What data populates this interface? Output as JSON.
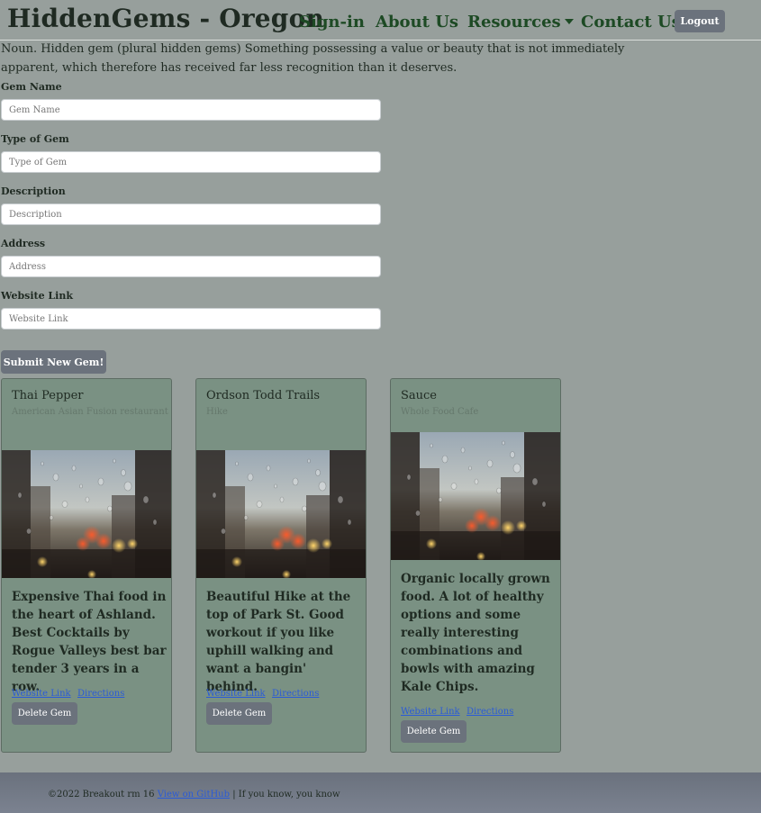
{
  "navbar": {
    "brand": "HiddenGems - Oregon",
    "links": [
      "Sign-in",
      "About Us",
      "Resources",
      "Contact Us"
    ],
    "logout_label": "Logout"
  },
  "intro": "Noun. Hidden gem (plural hidden gems) Something possessing a value or beauty that is not immediately apparent, which therefore has received far less recognition than it deserves.",
  "form": {
    "fields": [
      {
        "label": "Gem Name",
        "placeholder": "Gem Name",
        "value": ""
      },
      {
        "label": "Type of Gem",
        "placeholder": "Type of Gem",
        "value": ""
      },
      {
        "label": "Description",
        "placeholder": "Description",
        "value": ""
      },
      {
        "label": "Address",
        "placeholder": "Address",
        "value": ""
      },
      {
        "label": "Website Link",
        "placeholder": "Website Link",
        "value": ""
      }
    ],
    "submit_label": "Submit New Gem!"
  },
  "cards": [
    {
      "title": "Thai Pepper",
      "subtitle": "American Asian Fusion restaurant",
      "text": "Expensive Thai food in the heart of Ashland. Best Cocktails by Rogue Valleys best bar tender 3 years in a row.",
      "website_link": "Website Link",
      "directions_link": "Directions",
      "delete_label": "Delete Gem"
    },
    {
      "title": "Ordson Todd Trails",
      "subtitle": "Hike",
      "text": "Beautiful Hike at the top of Park St. Good workout if you like uphill walking and want a bangin' behind.",
      "website_link": "Website Link",
      "directions_link": "Directions",
      "delete_label": "Delete Gem"
    },
    {
      "title": "Sauce",
      "subtitle": "Whole Food Cafe",
      "text": "Organic locally grown food. A lot of healthy options and some really interesting combinations and bowls with amazing Kale Chips.",
      "website_link": "Website Link",
      "directions_link": "Directions",
      "delete_label": "Delete Gem"
    }
  ],
  "footer": {
    "copyright": "©2022 Breakout rm 16",
    "github_link": "View on GitHub",
    "tagline": "| If you know, you know"
  }
}
